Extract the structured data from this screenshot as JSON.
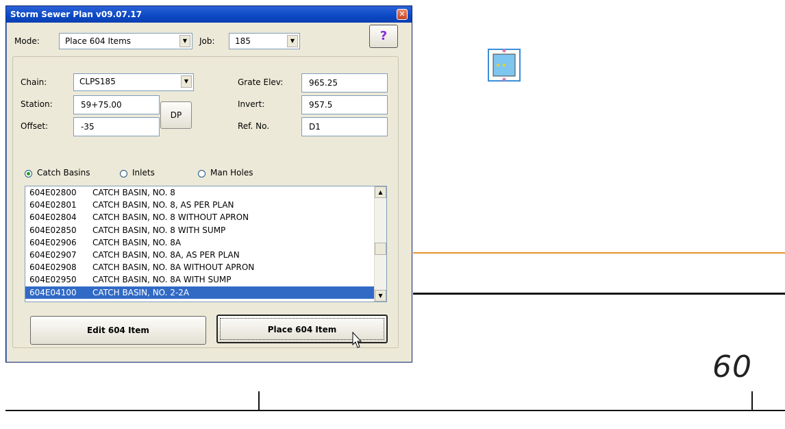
{
  "window": {
    "title": "Storm Sewer Plan v09.07.17",
    "close_symbol": "✕"
  },
  "mode": {
    "label": "Mode:",
    "value": "Place 604 Items"
  },
  "job": {
    "label": "Job:",
    "value": "185"
  },
  "help_label": "?",
  "chain": {
    "label": "Chain:",
    "value": "CLPS185"
  },
  "station": {
    "label": "Station:",
    "value": "59+75.00"
  },
  "offset": {
    "label": "Offset:",
    "value": "-35"
  },
  "dp_label": "DP",
  "grate_elev": {
    "label": "Grate Elev:",
    "value": "965.25"
  },
  "invert": {
    "label": "Invert:",
    "value": "957.5"
  },
  "ref_no": {
    "label": "Ref. No.",
    "value": "D1"
  },
  "radios": {
    "catch_basins": "Catch Basins",
    "inlets": "Inlets",
    "man_holes": "Man Holes",
    "selected": "catch_basins"
  },
  "items": [
    {
      "code": "604E02800",
      "desc": "CATCH BASIN, NO. 8"
    },
    {
      "code": "604E02801",
      "desc": "CATCH BASIN, NO. 8, AS PER PLAN"
    },
    {
      "code": "604E02804",
      "desc": "CATCH BASIN, NO. 8 WITHOUT APRON"
    },
    {
      "code": "604E02850",
      "desc": "CATCH BASIN, NO. 8 WITH SUMP"
    },
    {
      "code": "604E02906",
      "desc": "CATCH BASIN, NO. 8A"
    },
    {
      "code": "604E02907",
      "desc": "CATCH BASIN, NO. 8A, AS PER PLAN"
    },
    {
      "code": "604E02908",
      "desc": "CATCH BASIN, NO. 8A WITHOUT APRON"
    },
    {
      "code": "604E02950",
      "desc": "CATCH BASIN, NO. 8A WITH SUMP"
    },
    {
      "code": "604E04100",
      "desc": "CATCH BASIN, NO. 2-2A"
    }
  ],
  "selected_item_index": 8,
  "buttons": {
    "edit": "Edit 604 Item",
    "place": "Place 604 Item"
  },
  "canvas": {
    "station_number": "60"
  },
  "colors": {
    "title_bar": "#0b48c4",
    "selection": "#316ac5",
    "orange_line": "#e8912c"
  },
  "icons": {
    "dropdown": "chevron-down-icon",
    "scroll_up": "arrow-up-icon",
    "scroll_down": "arrow-down-icon"
  }
}
